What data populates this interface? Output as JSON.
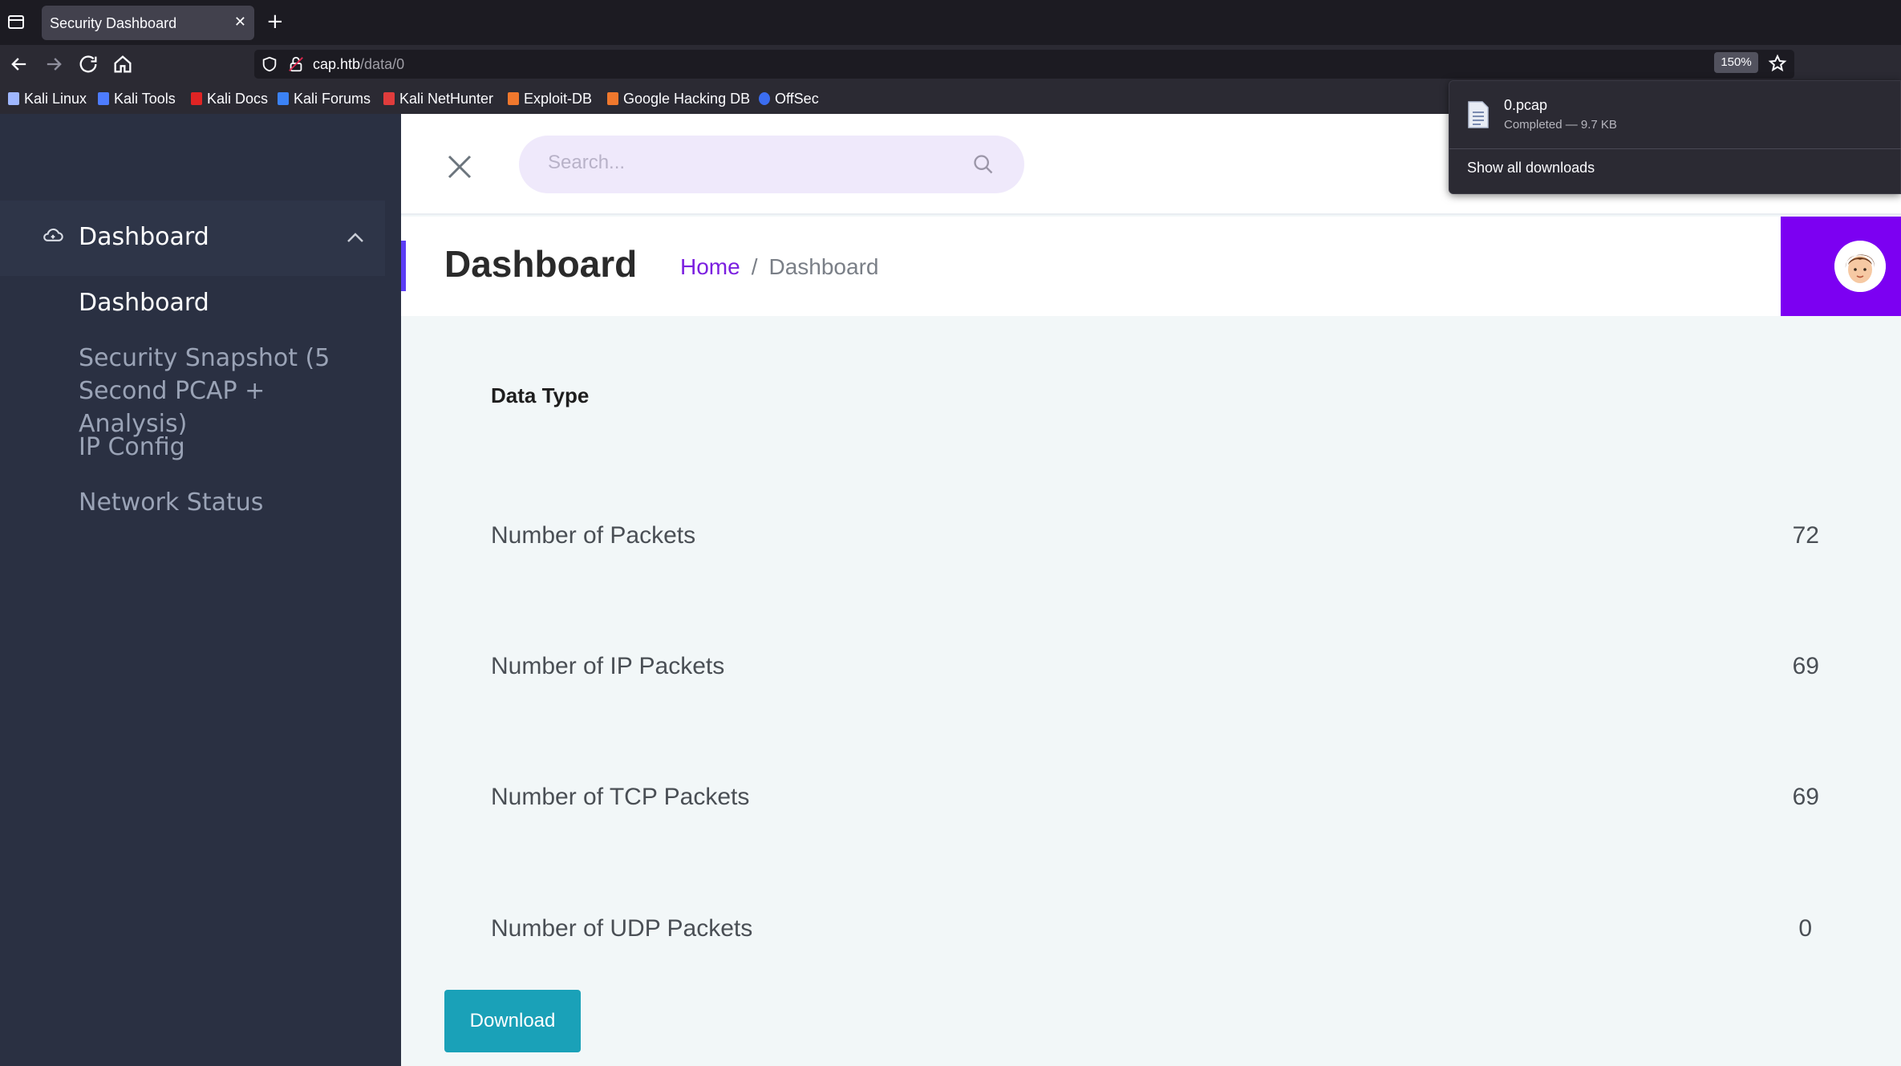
{
  "browser": {
    "tab_title": "Security Dashboard",
    "url_host": "cap.htb",
    "url_path": "/data/0",
    "zoom": "150%",
    "bookmarks": [
      {
        "label": "Kali Linux",
        "icon": "kali-dragon-icon",
        "color": "#9fb7ff"
      },
      {
        "label": "Kali Tools",
        "icon": "kali-tools-icon",
        "color": "#4d7cff"
      },
      {
        "label": "Kali Docs",
        "icon": "kali-docs-icon",
        "color": "#e02424"
      },
      {
        "label": "Kali Forums",
        "icon": "kali-forums-icon",
        "color": "#3b82f6"
      },
      {
        "label": "Kali NetHunter",
        "icon": "nethunter-icon",
        "color": "#e03c3c"
      },
      {
        "label": "Exploit-DB",
        "icon": "exploit-db-icon",
        "color": "#f0782d"
      },
      {
        "label": "Google Hacking DB",
        "icon": "ghdb-icon",
        "color": "#f0782d"
      },
      {
        "label": "OffSec",
        "icon": "offsec-icon",
        "color": "#3b6df0"
      }
    ]
  },
  "downloads": {
    "file_name": "0.pcap",
    "status": "Completed — 9.7 KB",
    "show_all": "Show all downloads"
  },
  "sidebar": {
    "group_label": "Dashboard",
    "items": [
      {
        "label": "Dashboard",
        "active": true
      },
      {
        "label": "Security Snapshot (5 Second PCAP + Analysis)",
        "active": false
      },
      {
        "label": "IP Config",
        "active": false
      },
      {
        "label": "Network Status",
        "active": false
      }
    ]
  },
  "topbar": {
    "search_placeholder": "Search..."
  },
  "header": {
    "title": "Dashboard",
    "breadcrumb_home": "Home",
    "breadcrumb_sep": "/",
    "breadcrumb_current": "Dashboard"
  },
  "table": {
    "column_header": "Data Type",
    "rows": [
      {
        "label": "Number of Packets",
        "value": "72"
      },
      {
        "label": "Number of IP Packets",
        "value": "69"
      },
      {
        "label": "Number of TCP Packets",
        "value": "69"
      },
      {
        "label": "Number of UDP Packets",
        "value": "0"
      }
    ]
  },
  "actions": {
    "download_label": "Download"
  },
  "colors": {
    "accent": "#7c00f2",
    "download_button": "#1aa1b8",
    "sidebar_bg": "#2a3042"
  }
}
